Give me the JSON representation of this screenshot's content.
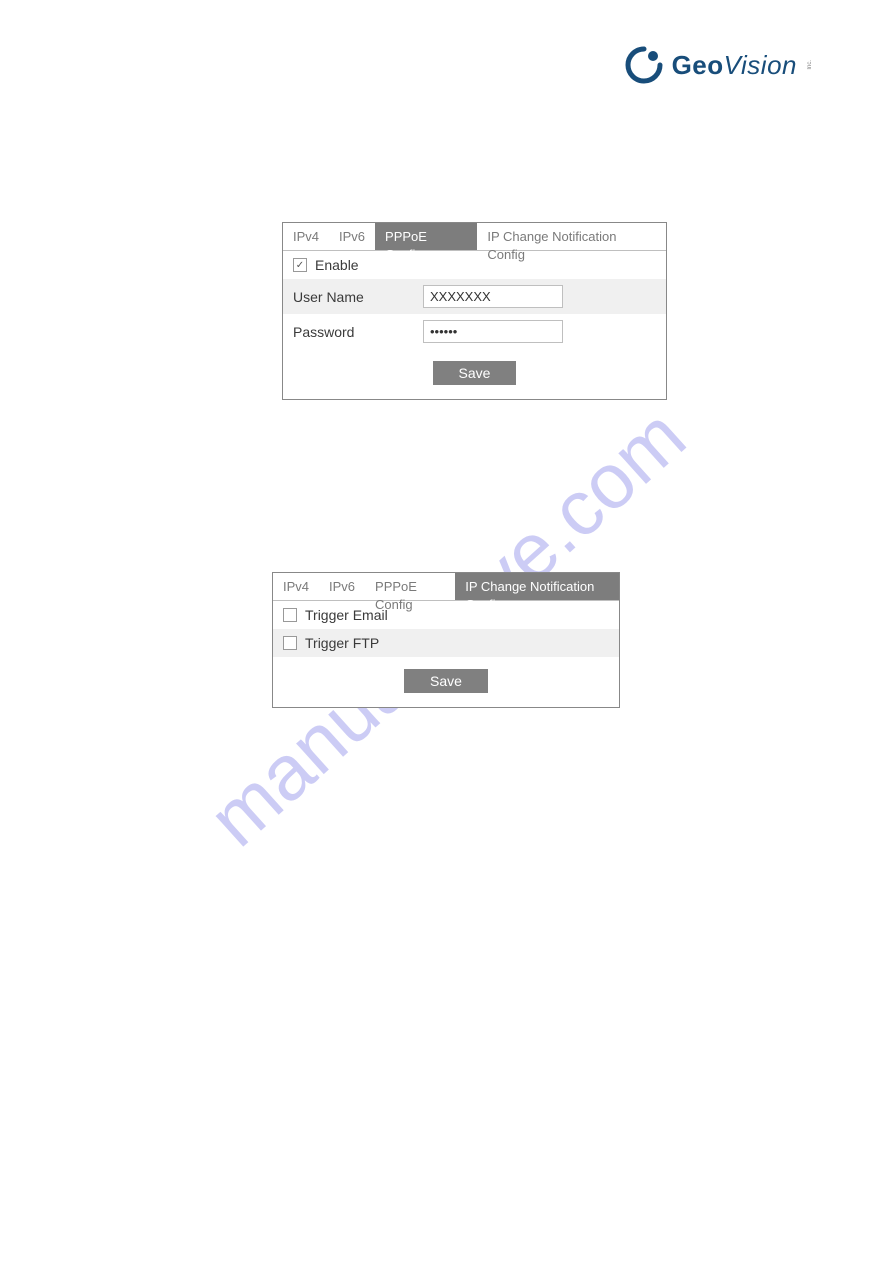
{
  "brand": {
    "geo": "Geo",
    "vision": "Vision",
    "inc": "Inc."
  },
  "watermark": "manualshive.com",
  "panel1": {
    "tabs": [
      "IPv4",
      "IPv6",
      "PPPoE Config",
      "IP Change Notification Config"
    ],
    "active_tab_index": 2,
    "enable_label": "Enable",
    "enable_checked": true,
    "fields": {
      "username_label": "User Name",
      "username_value": "XXXXXXX",
      "password_label": "Password",
      "password_value": "••••••"
    },
    "save_label": "Save"
  },
  "panel2": {
    "tabs": [
      "IPv4",
      "IPv6",
      "PPPoE Config",
      "IP Change Notification Config"
    ],
    "active_tab_index": 3,
    "trigger_email_label": "Trigger Email",
    "trigger_email_checked": false,
    "trigger_ftp_label": "Trigger FTP",
    "trigger_ftp_checked": false,
    "save_label": "Save"
  }
}
